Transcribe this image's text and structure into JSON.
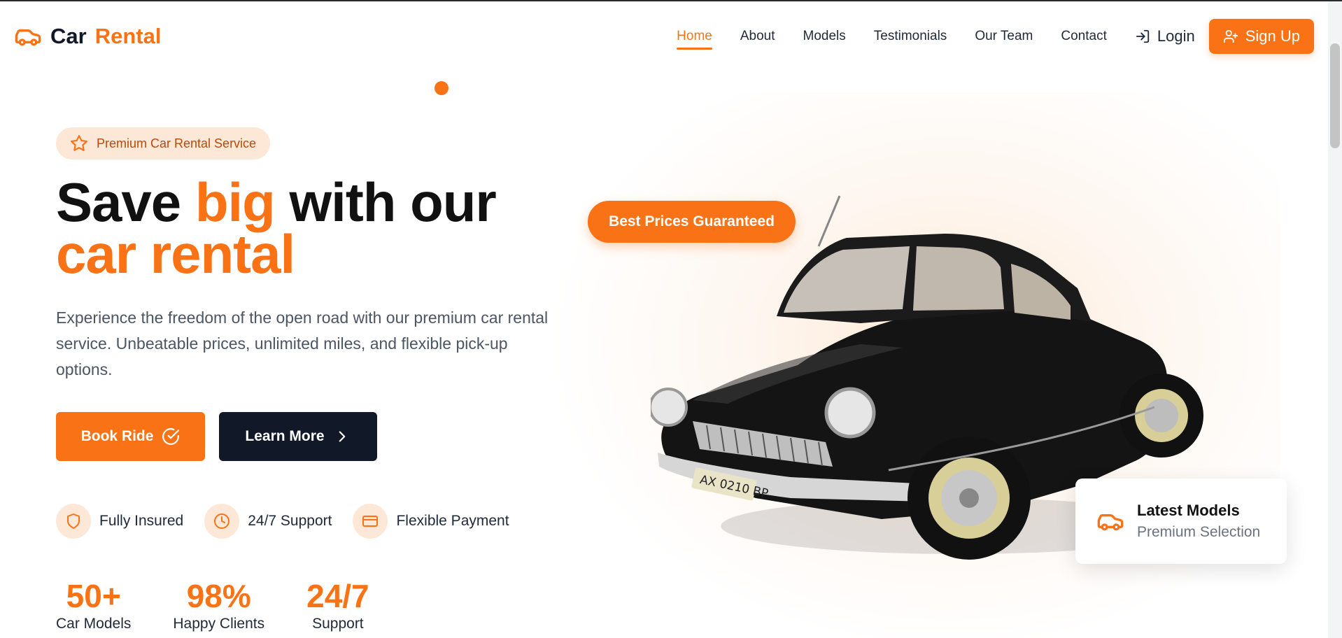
{
  "brand": {
    "name_part1": "Car",
    "name_part2": "Rental",
    "icon": "car-icon"
  },
  "nav": {
    "links": [
      {
        "label": "Home",
        "active": true
      },
      {
        "label": "About"
      },
      {
        "label": "Models"
      },
      {
        "label": "Testimonials"
      },
      {
        "label": "Our Team"
      },
      {
        "label": "Contact"
      }
    ],
    "login_label": "Login",
    "signup_label": "Sign Up"
  },
  "hero": {
    "badge": "Premium Car Rental Service",
    "headline_1": "Save ",
    "headline_big": "big",
    "headline_2": " with our",
    "headline_line2": "car rental",
    "description": "Experience the freedom of the open road with our premium car rental service. Unbeatable prices, unlimited miles, and flexible pick-up options.",
    "book_label": "Book Ride",
    "learn_label": "Learn More",
    "features": [
      {
        "label": "Fully Insured",
        "icon": "shield-icon"
      },
      {
        "label": "24/7 Support",
        "icon": "clock-icon"
      },
      {
        "label": "Flexible Payment",
        "icon": "credit-card-icon"
      }
    ],
    "stats": [
      {
        "value": "50+",
        "label": "Car Models"
      },
      {
        "value": "98%",
        "label": "Happy Clients"
      },
      {
        "value": "24/7",
        "label": "Support"
      }
    ],
    "price_pill": "Best Prices Guaranteed",
    "latest_card": {
      "title": "Latest Models",
      "subtitle": "Premium Selection"
    }
  },
  "colors": {
    "accent": "#f97316",
    "dark": "#111827",
    "badge_bg": "#fde7d6"
  }
}
